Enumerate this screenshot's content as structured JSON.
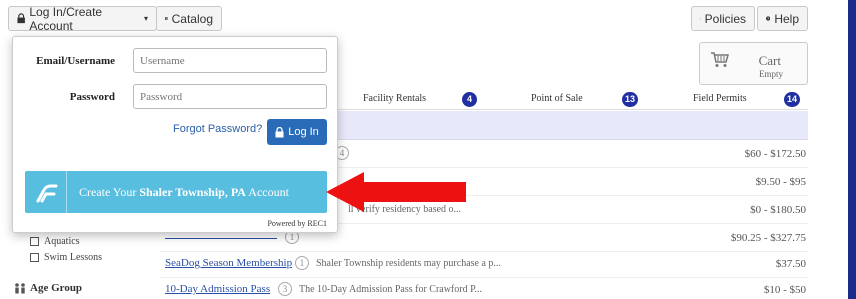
{
  "top_nav": {
    "login_label": "Log In/Create Account",
    "catalog_label": "Catalog",
    "policies_label": "Policies",
    "help_label": "Help"
  },
  "cart": {
    "label": "Cart",
    "status": "Empty"
  },
  "tabs": [
    {
      "label": "Facility Rentals",
      "count": "4"
    },
    {
      "label": "Point of Sale",
      "count": "13"
    },
    {
      "label": "Field Permits",
      "count": "14"
    }
  ],
  "rows": [
    {
      "num": "4",
      "price": "$60 - $172.50"
    },
    {
      "price": "$9.50 - $95"
    },
    {
      "desc": "ll verify residency based o...",
      "price": "$0 - $180.50"
    },
    {
      "num": "1",
      "price": "$90.25 - $327.75"
    },
    {
      "link": "SeaDog Season Membership",
      "num": "1",
      "desc": "Shaler Township residents may purchase a p...",
      "price": "$37.50"
    },
    {
      "link": "10-Day Admission Pass",
      "num": "3",
      "desc": "The 10-Day Admission Pass for Crawford P...",
      "price": "$10 - $50"
    }
  ],
  "sidebar": {
    "checkboxes": [
      "Aquatics",
      "Swim Lessons"
    ],
    "age_group_label": "Age Group"
  },
  "login_dropdown": {
    "email_label": "Email/Username",
    "email_placeholder": "Username",
    "password_label": "Password",
    "password_placeholder": "Password",
    "forgot_label": "Forgot Password?",
    "login_button": "Log In",
    "create_prefix": "Create Your",
    "create_org": "Shaler Township, PA",
    "create_suffix": "Account",
    "powered_by": "Powered by REC1"
  },
  "colors": {
    "accent": "#2a6bb8",
    "create": "#57bedf",
    "badge": "#2030a0",
    "arrow": "#ee1111",
    "frame": "#1a2b8c"
  }
}
